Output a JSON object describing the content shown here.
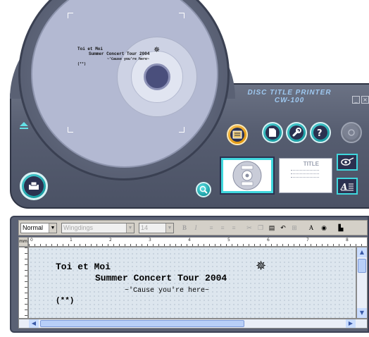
{
  "app": {
    "title_line1": "DISC TITLE PRINTER",
    "title_line2": "CW-100"
  },
  "disc_label": {
    "line1": "Toi et Moi",
    "line2": "Summer Concert Tour 2004",
    "line3": "~'Cause you're here~",
    "line4": "(**)",
    "symbol": "✵"
  },
  "preview_card": {
    "title": "TITLE"
  },
  "toolbar": {
    "style_value": "Normal",
    "font_value": "Wingdings",
    "size_value": "14",
    "bold_label": "B",
    "italic_label": "I"
  },
  "ruler": {
    "unit": "mm",
    "ticks": [
      "0",
      "1",
      "2",
      "3",
      "4",
      "5",
      "6",
      "7",
      "8"
    ]
  },
  "editor": {
    "line1": "Toi et Moi",
    "line2": "Summer Concert Tour 2004",
    "line3": "~'Cause you're here~",
    "line4": "(**)",
    "symbol": "✵"
  },
  "icons": {
    "eject": "eject-icon",
    "print": "printer-icon",
    "zoom": "magnifier-icon",
    "new": "new-document-icon",
    "settings": "wrench-icon",
    "help": "help-icon",
    "sound": "speaker-icon"
  },
  "colors": {
    "accent_cyan": "#40d7dd",
    "accent_orange": "#e39a12",
    "panel": "#5a6174",
    "disc": "#b3b9d2"
  }
}
